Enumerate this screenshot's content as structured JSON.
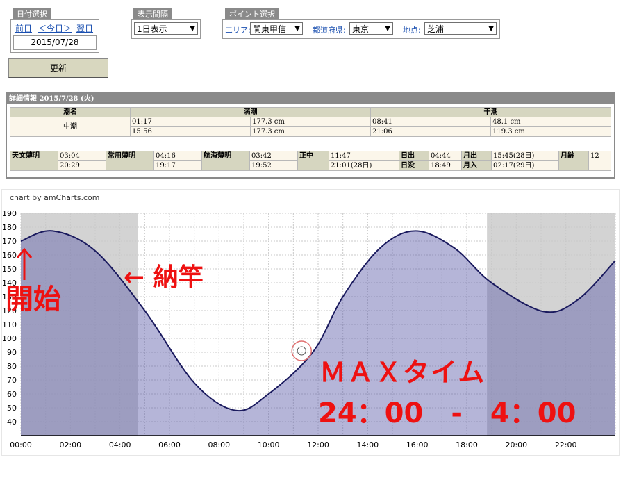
{
  "date_panel": {
    "tab": "日付選択",
    "prev": "前日",
    "today": "＜今日＞",
    "next": "翌日",
    "date_value": "2015/07/28"
  },
  "interval_panel": {
    "tab": "表示間隔",
    "selected": "1日表示"
  },
  "point_panel": {
    "tab": "ポイント選択",
    "area_label": "エリア:",
    "area_value": "関東甲信",
    "pref_label": "都道府県:",
    "pref_value": "東京",
    "place_label": "地点:",
    "place_value": "芝浦"
  },
  "update_button": "更新",
  "detail": {
    "title": "詳細情報  2015/7/28 (火)",
    "headers": {
      "tide_name": "潮名",
      "high": "満潮",
      "low": "干潮"
    },
    "tide_name": "中潮",
    "high": [
      {
        "time": "01:17",
        "height": "177.3 cm"
      },
      {
        "time": "15:56",
        "height": "177.3 cm"
      }
    ],
    "low": [
      {
        "time": "08:41",
        "height": "48.1 cm"
      },
      {
        "time": "21:06",
        "height": "119.3 cm"
      }
    ],
    "astro": {
      "astro_twilight": {
        "label": "天文薄明",
        "v1": "03:04",
        "v2": "20:29"
      },
      "civil_twilight": {
        "label": "常用薄明",
        "v1": "04:16",
        "v2": "19:17"
      },
      "nautical_twilight": {
        "label": "航海薄明",
        "v1": "03:42",
        "v2": "19:52"
      },
      "noon": {
        "label": "正中",
        "v1": "11:47",
        "v2": "21:01(28日)"
      },
      "sunrise": {
        "label": "日出",
        "v": "04:44"
      },
      "sunset": {
        "label": "日没",
        "v": "18:49"
      },
      "moonrise": {
        "label": "月出",
        "v": "15:45(28日)"
      },
      "moonset": {
        "label": "月入",
        "v": "02:17(29日)"
      },
      "moon_age": {
        "label": "月齢",
        "v": "12"
      }
    }
  },
  "chart_credit": "chart by amCharts.com",
  "chart_data": {
    "type": "area",
    "title": "",
    "xlabel": "",
    "ylabel": "",
    "ylim": [
      30,
      190
    ],
    "xlim": [
      "00:00",
      "24:00"
    ],
    "yticks": [
      40,
      50,
      60,
      70,
      80,
      90,
      100,
      110,
      120,
      130,
      140,
      150,
      160,
      170,
      180,
      190
    ],
    "xticks": [
      "00:00",
      "02:00",
      "04:00",
      "06:00",
      "08:00",
      "10:00",
      "12:00",
      "14:00",
      "16:00",
      "18:00",
      "20:00",
      "22:00"
    ],
    "series": [
      {
        "x": [
          "00:00",
          "01:17",
          "03:00",
          "05:00",
          "07:00",
          "08:41",
          "10:00",
          "11:47",
          "13:00",
          "14:30",
          "15:56",
          "17:30",
          "19:00",
          "21:06",
          "22:30",
          "24:00"
        ],
        "values": [
          170,
          177.3,
          163,
          120,
          68,
          48.1,
          60,
          90,
          130,
          165,
          177.3,
          165,
          140,
          119.3,
          128,
          156
        ]
      }
    ],
    "night_bands": [
      [
        "00:00",
        "04:44"
      ],
      [
        "18:49",
        "24:00"
      ]
    ],
    "current_marker": {
      "x": "11:20",
      "y": 91
    },
    "grid": true,
    "colors": {
      "line": "#1a1a5e",
      "fill": "#a9a9cd",
      "night": "#d3d3d3"
    }
  },
  "annotations": {
    "start": "開始",
    "arrow_label": "← 納竿",
    "max_time": "ＭＡＸタイム",
    "max_range": "24：00　-　4：00"
  }
}
